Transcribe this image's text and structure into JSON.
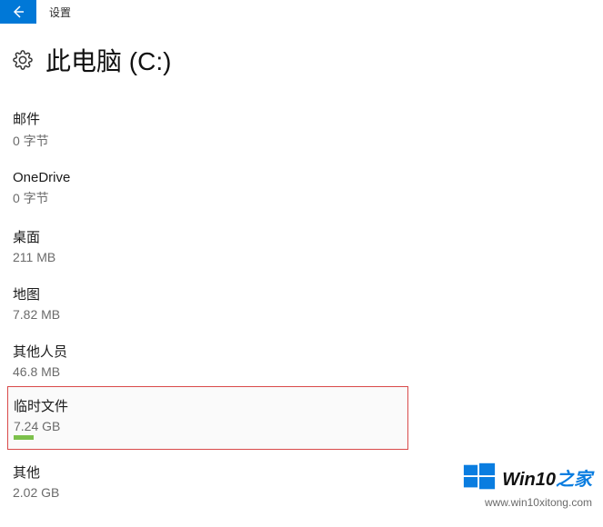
{
  "topbar": {
    "title": "设置"
  },
  "header": {
    "title": "此电脑 (C:)"
  },
  "storage": {
    "items": [
      {
        "label": "邮件",
        "size": "0 字节",
        "highlighted": false
      },
      {
        "label": "OneDrive",
        "size": "0 字节",
        "highlighted": false
      },
      {
        "label": "桌面",
        "size": "211 MB",
        "highlighted": false
      },
      {
        "label": "地图",
        "size": "7.82 MB",
        "highlighted": false
      },
      {
        "label": "其他人员",
        "size": "46.8 MB",
        "highlighted": false
      },
      {
        "label": "临时文件",
        "size": "7.24 GB",
        "highlighted": true
      },
      {
        "label": "其他",
        "size": "2.02 GB",
        "highlighted": false
      }
    ]
  },
  "watermark": {
    "brand_main": "Win10",
    "brand_accent": "之家",
    "url": "www.win10xitong.com"
  }
}
